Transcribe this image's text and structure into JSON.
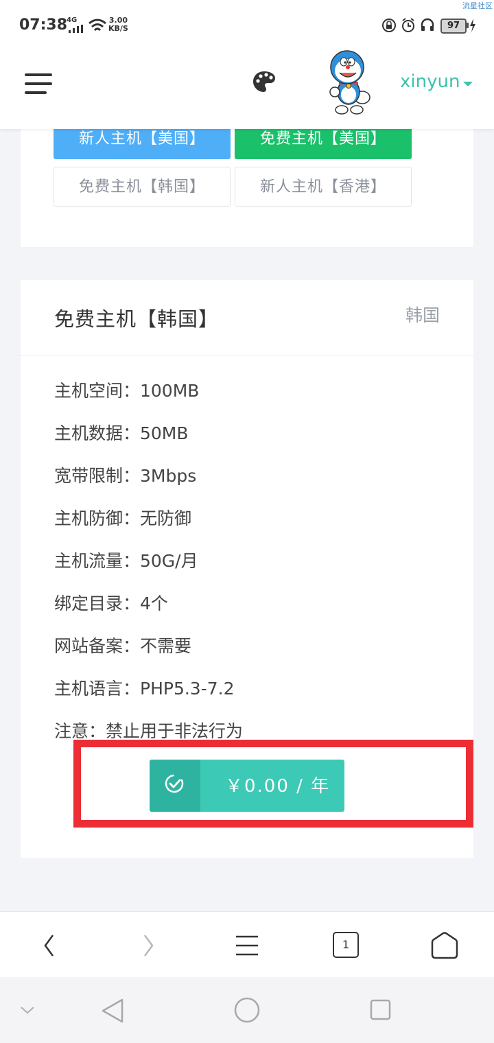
{
  "status_bar": {
    "time": "07:38",
    "network": "4G",
    "speed_value": "3.00",
    "speed_unit": "KB/S",
    "battery": "97",
    "watermark": "流星社区"
  },
  "header": {
    "username": "xinyun",
    "accent_color": "#3cc2ae"
  },
  "plan_buttons": [
    {
      "label": "新人主机【美国】",
      "style": "blue"
    },
    {
      "label": "免费主机【美国】",
      "style": "green"
    },
    {
      "label": "免费主机【韩国】",
      "style": "outline"
    },
    {
      "label": "新人主机【香港】",
      "style": "outline"
    }
  ],
  "plan_card": {
    "title": "免费主机【韩国】",
    "region": "韩国",
    "specs": [
      "主机空间：100MB",
      "主机数据：50MB",
      "宽带限制：3Mbps",
      "主机防御：无防御",
      "主机流量：50G/月",
      "绑定目录：4个",
      "网站备案：不需要",
      "主机语言：PHP5.3-7.2",
      "注意：禁止用于非法行为"
    ],
    "price_label": "￥0.00 / 年"
  },
  "browser_toolbar": {
    "tab_count": "1",
    "icons": [
      "back-icon",
      "forward-icon",
      "menu-icon",
      "tabs-icon",
      "home-icon"
    ]
  },
  "system_nav": {
    "icons": [
      "collapse-icon",
      "nav-back-icon",
      "nav-home-icon",
      "nav-recents-icon"
    ]
  }
}
